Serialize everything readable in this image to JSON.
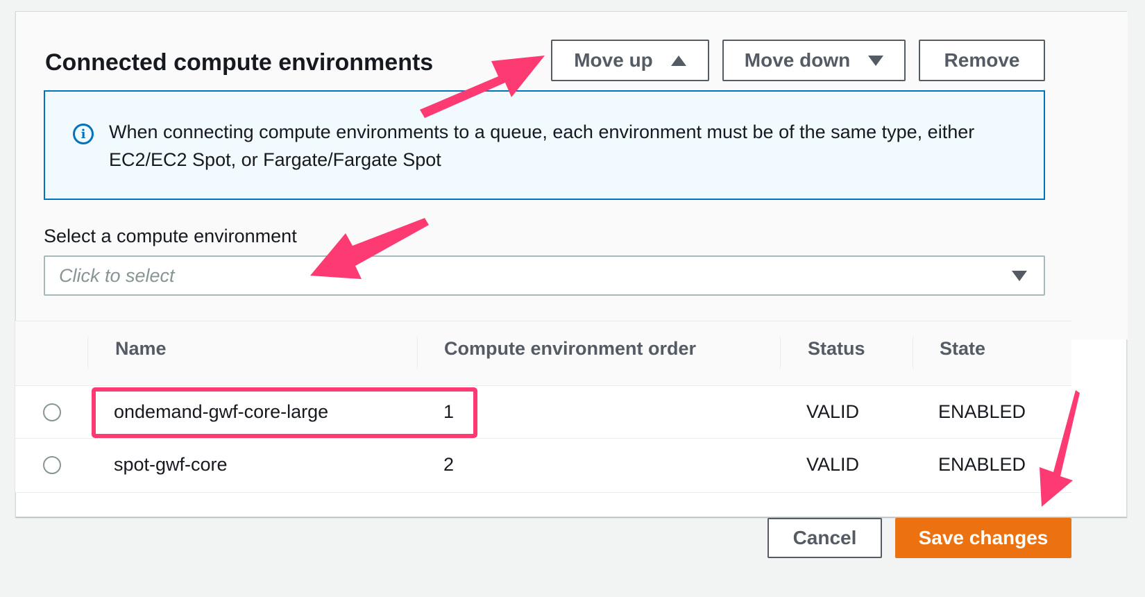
{
  "section": {
    "title": "Connected compute environments"
  },
  "toolbar": {
    "move_up_label": "Move up",
    "move_down_label": "Move down",
    "remove_label": "Remove"
  },
  "info_alert": {
    "icon": "info-icon",
    "text": "When connecting compute environments to a queue, each environment must be of the same type, either EC2/EC2 Spot, or Fargate/Fargate Spot"
  },
  "select": {
    "label": "Select a compute environment",
    "placeholder": "Click to select"
  },
  "table": {
    "columns": [
      "Name",
      "Compute environment order",
      "Status",
      "State"
    ],
    "rows": [
      {
        "name": "ondemand-gwf-core-large",
        "order": "1",
        "status": "VALID",
        "state": "ENABLED"
      },
      {
        "name": "spot-gwf-core",
        "order": "2",
        "status": "VALID",
        "state": "ENABLED"
      }
    ]
  },
  "footer": {
    "cancel_label": "Cancel",
    "save_label": "Save changes"
  },
  "colors": {
    "primary_button": "#ec7211",
    "info_border": "#0073bb",
    "annotation": "#fd3a72"
  }
}
